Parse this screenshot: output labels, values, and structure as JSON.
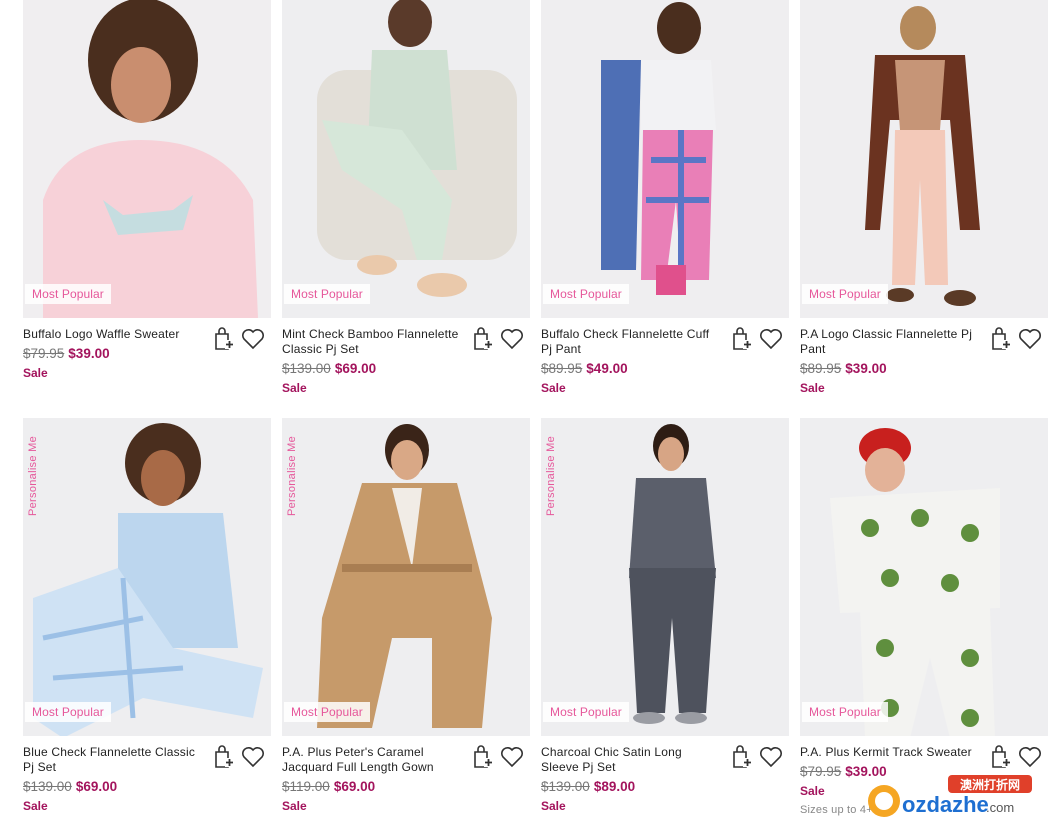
{
  "products": [
    {
      "title": "Buffalo Logo Waffle Sweater",
      "was": "$79.95",
      "now": "$39.00",
      "sale": "Sale",
      "badge": "Most Popular",
      "personalise": ""
    },
    {
      "title": "Mint Check Bamboo Flannelette Classic Pj Set",
      "was": "$139.00",
      "now": "$69.00",
      "sale": "Sale",
      "badge": "Most Popular",
      "personalise": ""
    },
    {
      "title": "Buffalo Check Flannelette Cuff Pj Pant",
      "was": "$89.95",
      "now": "$49.00",
      "sale": "Sale",
      "badge": "Most Popular",
      "personalise": ""
    },
    {
      "title": "P.A Logo Classic Flannelette Pj Pant",
      "was": "$89.95",
      "now": "$39.00",
      "sale": "Sale",
      "badge": "Most Popular",
      "personalise": ""
    },
    {
      "title": "Blue Check Flannelette Classic Pj Set",
      "was": "$139.00",
      "now": "$69.00",
      "sale": "Sale",
      "badge": "Most Popular",
      "personalise": "Personalise Me"
    },
    {
      "title": "P.A. Plus Peter's Caramel Jacquard Full Length Gown",
      "was": "$119.00",
      "now": "$69.00",
      "sale": "Sale",
      "badge": "Most Popular",
      "personalise": "Personalise Me"
    },
    {
      "title": "Charcoal Chic Satin Long Sleeve Pj Set",
      "was": "$139.00",
      "now": "$89.00",
      "sale": "Sale",
      "badge": "Most Popular",
      "personalise": "Personalise Me"
    },
    {
      "title": "P.A. Plus Kermit Track Sweater",
      "was": "$79.95",
      "now": "$39.00",
      "sale": "Sale",
      "badge": "Most Popular",
      "personalise": "",
      "sizes": "Sizes up to 4+"
    }
  ],
  "watermark": {
    "cn": "澳洲打折网",
    "domain": "ozdazhe",
    "tld": ".com"
  },
  "colors": {
    "accent_pink": "#e6579a",
    "sale_purple": "#a3145d"
  },
  "icons": {
    "bag": "shopping-bag-add-icon",
    "wishlist": "heart-icon"
  }
}
